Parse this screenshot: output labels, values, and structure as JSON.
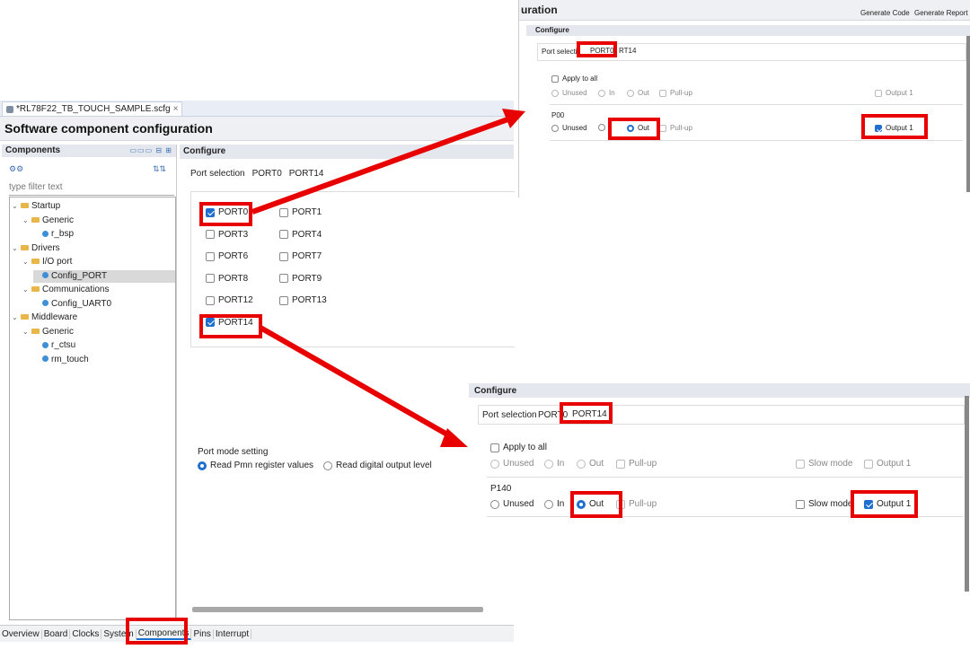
{
  "main": {
    "file_tab": "*RL78F22_TB_TOUCH_SAMPLE.scfg",
    "file_tab_close": "×",
    "title": "Software component configuration",
    "components_header": "Components",
    "configure_header": "Configure",
    "filter_placeholder": "type filter text",
    "tree": [
      {
        "label": "Startup",
        "type": "folder"
      },
      {
        "label": "Generic",
        "type": "folder"
      },
      {
        "label": "r_bsp",
        "type": "file"
      },
      {
        "label": "Drivers",
        "type": "folder"
      },
      {
        "label": "I/O port",
        "type": "folder"
      },
      {
        "label": "Config_PORT",
        "type": "file"
      },
      {
        "label": "Communications",
        "type": "folder"
      },
      {
        "label": "Config_UART0",
        "type": "file"
      },
      {
        "label": "Middleware",
        "type": "folder"
      },
      {
        "label": "Generic",
        "type": "folder"
      },
      {
        "label": "r_ctsu",
        "type": "file"
      },
      {
        "label": "rm_touch",
        "type": "file"
      }
    ],
    "port_selection": {
      "label": "Port selection",
      "tabs": [
        "PORT0",
        "PORT14"
      ]
    },
    "ports": [
      {
        "label": "PORT0",
        "checked": true
      },
      {
        "label": "PORT1",
        "checked": false
      },
      {
        "label": "PORT3",
        "checked": false
      },
      {
        "label": "PORT4",
        "checked": false
      },
      {
        "label": "PORT6",
        "checked": false
      },
      {
        "label": "PORT7",
        "checked": false
      },
      {
        "label": "PORT8",
        "checked": false
      },
      {
        "label": "PORT9",
        "checked": false
      },
      {
        "label": "PORT12",
        "checked": false
      },
      {
        "label": "PORT13",
        "checked": false
      },
      {
        "label": "PORT14",
        "checked": true
      }
    ],
    "port_mode": {
      "label": "Port mode setting",
      "option1": "Read Pmn register values",
      "option2": "Read digital output level"
    },
    "bottom_tabs": [
      "Overview",
      "Board",
      "Clocks",
      "System",
      "Components",
      "Pins",
      "Interrupt"
    ]
  },
  "inset_port0": {
    "title": "uration",
    "generate_code": "Generate Code",
    "generate_report": "Generate Report",
    "configure": "Configure",
    "port_selection": "Port selecti",
    "tab1": "PORT0",
    "tab2": "RT14",
    "apply_all": "Apply to all",
    "row_all": {
      "unused": "Unused",
      "in": "In",
      "out": "Out",
      "pullup": "Pull-up",
      "output1": "Output 1"
    },
    "pin": "P00",
    "row_pin": {
      "unused": "Unused",
      "out": "Out",
      "pullup": "Pull-up",
      "output1": "Output 1"
    }
  },
  "inset_port14": {
    "configure": "Configure",
    "port_selection": "Port selection",
    "tab1": "PORT0",
    "tab2": "PORT14",
    "apply_all": "Apply to all",
    "row_all": {
      "unused": "Unused",
      "in": "In",
      "out": "Out",
      "pullup": "Pull-up",
      "slow": "Slow mode",
      "output1": "Output 1"
    },
    "pin": "P140",
    "row_pin": {
      "unused": "Unused",
      "in": "In",
      "out": "Out",
      "pullup": "Pull-up",
      "slow": "Slow mode",
      "output1": "Output 1"
    }
  },
  "colors": {
    "highlight": "#e80000",
    "accent": "#1f6fcf"
  }
}
